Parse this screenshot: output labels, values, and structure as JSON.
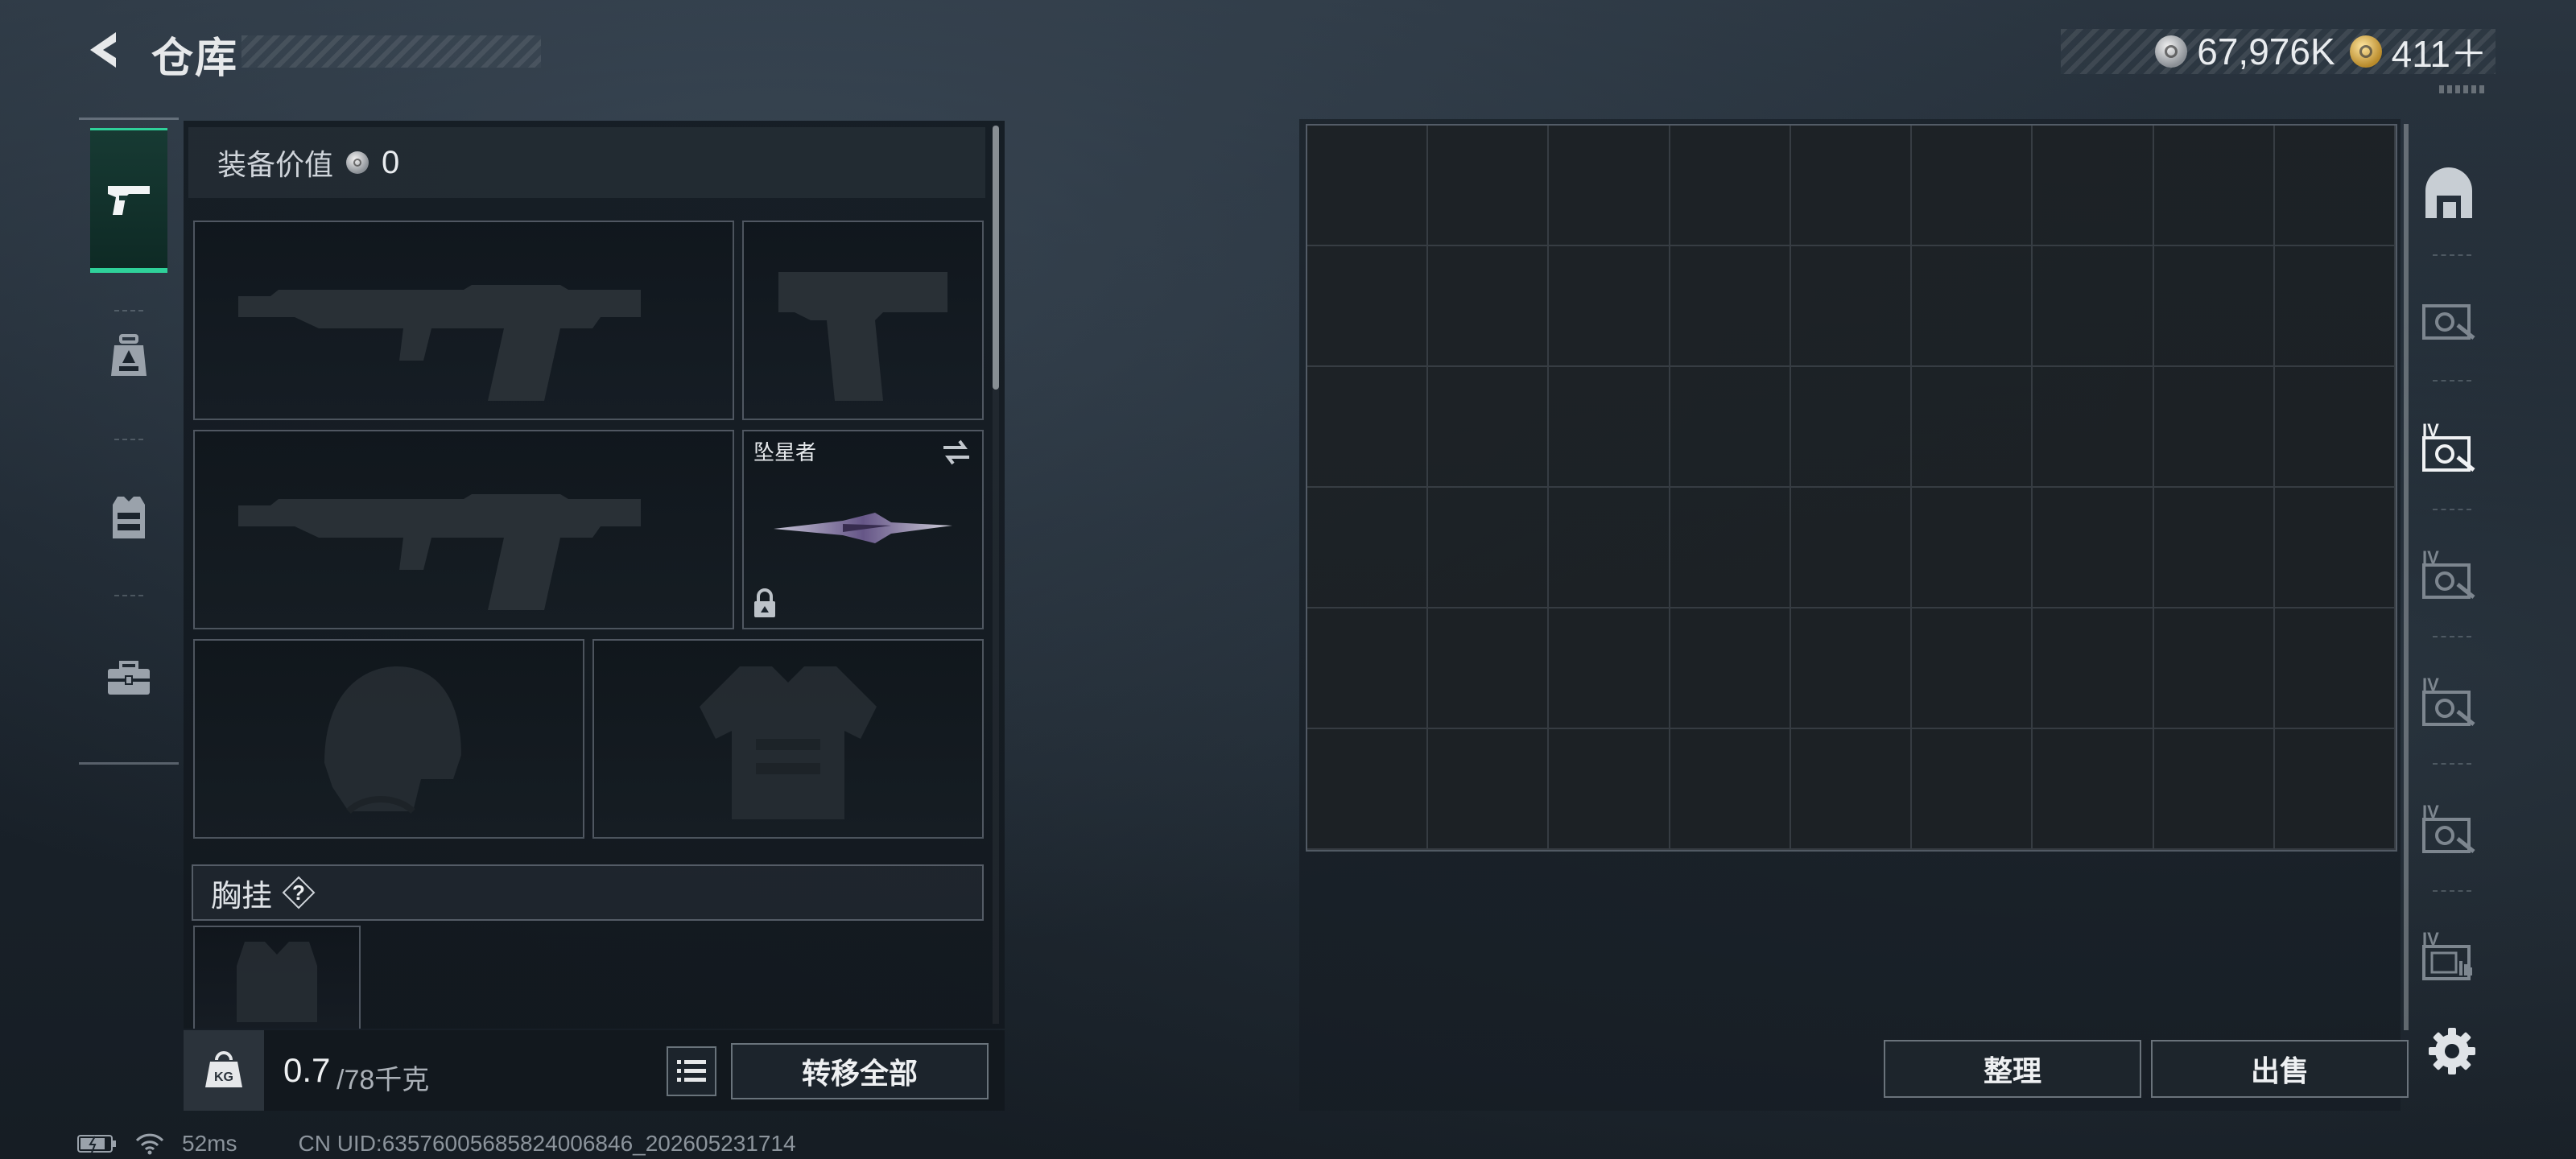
{
  "header": {
    "title": "仓库",
    "currencies": [
      {
        "icon": "silver-coin-icon",
        "value": "67,976K"
      },
      {
        "icon": "gold-coin-icon",
        "value": "411＋"
      }
    ]
  },
  "categories": [
    {
      "icon": "pistol-icon",
      "active": true
    },
    {
      "icon": "backpack-icon",
      "active": false
    },
    {
      "icon": "chest-rig-icon",
      "active": false
    },
    {
      "icon": "toolbox-icon",
      "active": false
    }
  ],
  "equipment": {
    "value_label": "装备价值",
    "value": "0",
    "melee_name": "坠星者",
    "chest_rig_label": "胸挂",
    "chest_rig_help": "?"
  },
  "weight": {
    "current": "0.7",
    "max": "/78千克",
    "icon_text": "KG"
  },
  "actions": {
    "transfer_all": "转移全部",
    "sort": "整理",
    "sell": "出售"
  },
  "storage_tabs": [
    {
      "icon": "home-storage-icon"
    },
    {
      "icon": "storage-unit-icon"
    },
    {
      "icon": "storage-unit-iv-icon",
      "label": "IV"
    },
    {
      "icon": "storage-unit-iv-icon",
      "label": "IV"
    },
    {
      "icon": "storage-unit-iv-icon",
      "label": "IV"
    },
    {
      "icon": "storage-unit-iv-icon",
      "label": "IV"
    },
    {
      "icon": "storage-unit-iv-icon",
      "label": "IV"
    }
  ],
  "status": {
    "ping": "52ms",
    "uid": "CN UID:63576005685824006846_202605231714"
  },
  "colors": {
    "accent": "#2fd19a",
    "panel": "#141b22",
    "border": "#96a0ac"
  }
}
